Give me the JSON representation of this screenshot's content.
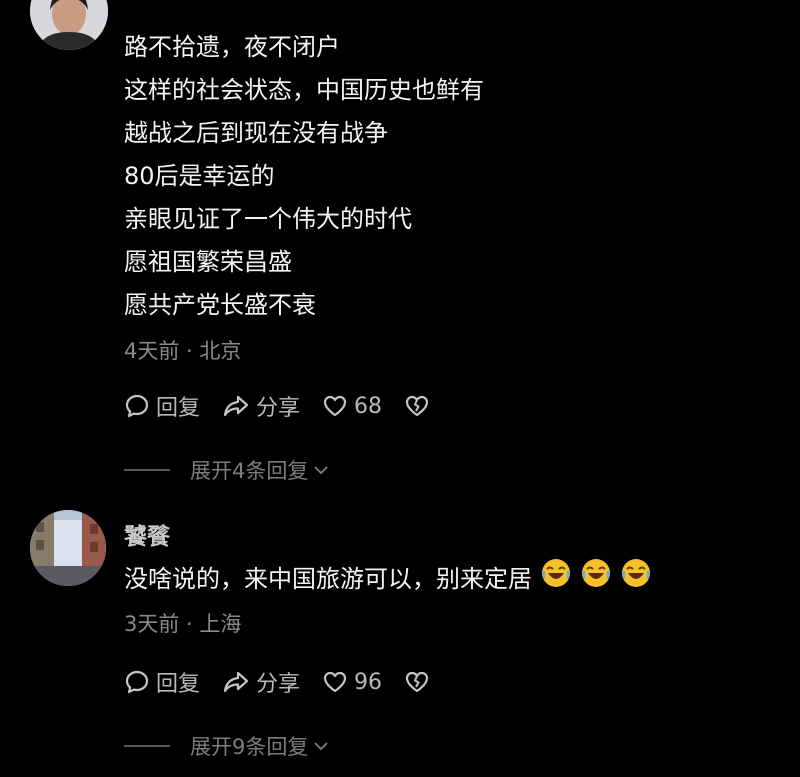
{
  "comments": [
    {
      "lines": [
        "路不拾遗，夜不闭户",
        "这样的社会状态，中国历史也鲜有",
        "越战之后到现在没有战争",
        "80后是幸运的",
        "亲眼见证了一个伟大的时代",
        "愿祖国繁荣昌盛",
        "愿共产党长盛不衰"
      ],
      "meta": "4天前 · 北京",
      "reply_label": "回复",
      "share_label": "分享",
      "likes": "68",
      "expand_label": "展开4条回复"
    },
    {
      "username": "饕餮",
      "text": "没啥说的，来中国旅游可以，别来定居",
      "emoji": [
        "laughing-crying-emoji",
        "laughing-crying-emoji",
        "laughing-crying-emoji"
      ],
      "meta": "3天前 · 上海",
      "reply_label": "回复",
      "share_label": "分享",
      "likes": "96",
      "expand_label": "展开9条回复"
    }
  ],
  "colors": {
    "background": "#000000",
    "text": "#f4f4f4",
    "meta": "#8a8a8a",
    "emoji": "#f6c026"
  }
}
